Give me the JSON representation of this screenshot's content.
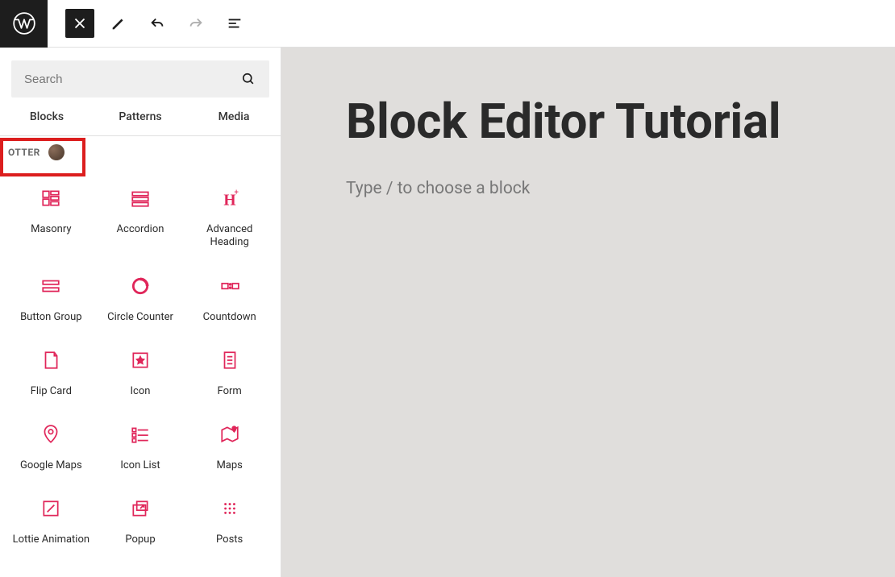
{
  "search": {
    "placeholder": "Search"
  },
  "tabs": {
    "blocks": "Blocks",
    "patterns": "Patterns",
    "media": "Media"
  },
  "category": {
    "label": "OTTER"
  },
  "blocks": {
    "masonry": "Masonry",
    "accordion": "Accordion",
    "advanced_heading": "Advanced Heading",
    "button_group": "Button Group",
    "circle_counter": "Circle Counter",
    "countdown": "Countdown",
    "flip_card": "Flip Card",
    "icon": "Icon",
    "form": "Form",
    "google_maps": "Google Maps",
    "icon_list": "Icon List",
    "maps": "Maps",
    "lottie": "Lottie Animation",
    "popup": "Popup",
    "posts": "Posts"
  },
  "article": {
    "title": "Block Editor Tutorial",
    "placeholder": "Type / to choose a block"
  }
}
